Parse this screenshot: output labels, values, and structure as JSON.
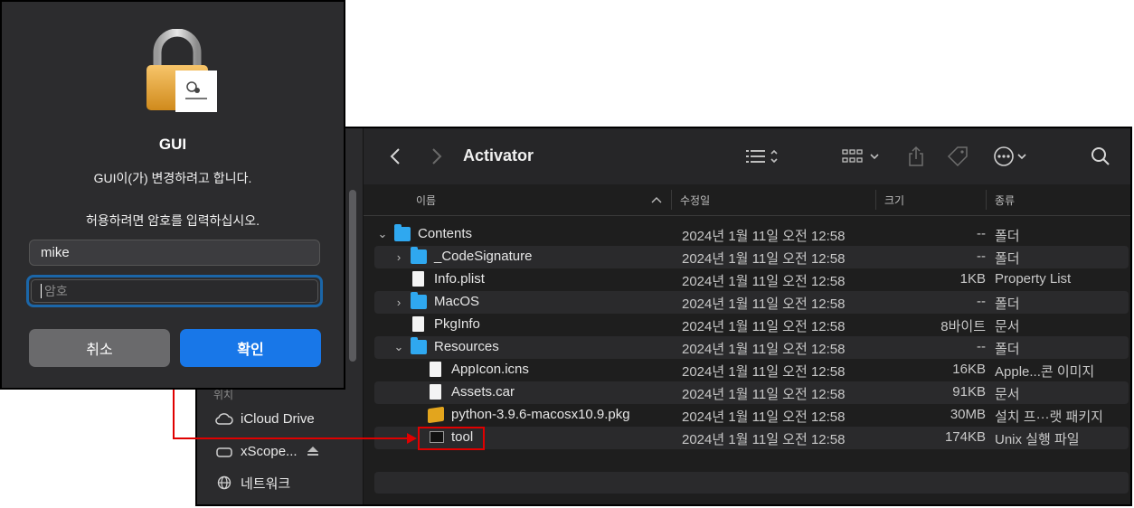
{
  "dialog": {
    "title": "GUI",
    "message": "GUI이(가) 변경하려고 합니다.",
    "instruction": "허용하려면 암호를 입력하십시오.",
    "username_value": "mike",
    "password_placeholder": "암호",
    "cancel_label": "취소",
    "ok_label": "확인"
  },
  "finder": {
    "title": "Activator",
    "columns": {
      "name": "이름",
      "date": "수정일",
      "size": "크기",
      "kind": "종류"
    },
    "sidebar": {
      "section_label": "위치",
      "items": [
        {
          "label": "iCloud Drive",
          "icon": "cloud-icon"
        },
        {
          "label": "xScope...",
          "icon": "disk-icon"
        },
        {
          "label": "네트워크",
          "icon": "globe-icon"
        }
      ]
    },
    "rows": [
      {
        "name": "Contents",
        "date": "2024년 1월 11일 오전 12:58",
        "size": "--",
        "kind": "폴더",
        "icon": "folder-icon",
        "level": 0,
        "chevron": "down"
      },
      {
        "name": "_CodeSignature",
        "date": "2024년 1월 11일 오전 12:58",
        "size": "--",
        "kind": "폴더",
        "icon": "folder-icon",
        "level": 1,
        "chevron": "right"
      },
      {
        "name": "Info.plist",
        "date": "2024년 1월 11일 오전 12:58",
        "size": "1KB",
        "kind": "Property List",
        "icon": "document-icon",
        "level": 1,
        "chevron": ""
      },
      {
        "name": "MacOS",
        "date": "2024년 1월 11일 오전 12:58",
        "size": "--",
        "kind": "폴더",
        "icon": "folder-icon",
        "level": 1,
        "chevron": "right"
      },
      {
        "name": "PkgInfo",
        "date": "2024년 1월 11일 오전 12:58",
        "size": "8바이트",
        "kind": "문서",
        "icon": "document-icon",
        "level": 1,
        "chevron": ""
      },
      {
        "name": "Resources",
        "date": "2024년 1월 11일 오전 12:58",
        "size": "--",
        "kind": "폴더",
        "icon": "folder-icon",
        "level": 1,
        "chevron": "down"
      },
      {
        "name": "AppIcon.icns",
        "date": "2024년 1월 11일 오전 12:58",
        "size": "16KB",
        "kind": "Apple...콘 이미지",
        "icon": "document-icon",
        "level": 2,
        "chevron": ""
      },
      {
        "name": "Assets.car",
        "date": "2024년 1월 11일 오전 12:58",
        "size": "91KB",
        "kind": "문서",
        "icon": "document-icon",
        "level": 2,
        "chevron": ""
      },
      {
        "name": "python-3.9.6-macosx10.9.pkg",
        "date": "2024년 1월 11일 오전 12:58",
        "size": "30MB",
        "kind": "설치 프···랫 패키지",
        "icon": "package-icon",
        "level": 2,
        "chevron": ""
      },
      {
        "name": "tool",
        "date": "2024년 1월 11일 오전 12:58",
        "size": "174KB",
        "kind": "Unix 실행 파일",
        "icon": "terminal-icon",
        "level": 2,
        "chevron": ""
      }
    ]
  },
  "annotation": {
    "color": "#e00000",
    "highlighted_item": "tool"
  },
  "colors": {
    "accent": "#1877e8",
    "folder": "#2fa8f0"
  }
}
